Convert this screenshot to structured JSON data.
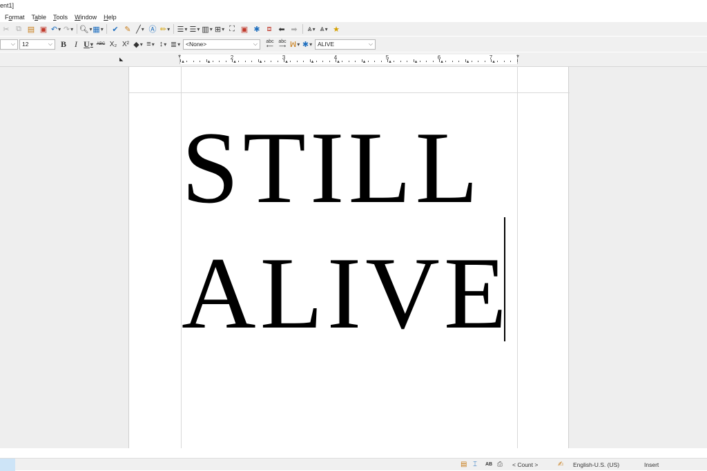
{
  "window": {
    "title_fragment": "ent1]"
  },
  "menu": [
    {
      "label": "Format",
      "key": "o"
    },
    {
      "label": "Table",
      "key": "a"
    },
    {
      "label": "Tools",
      "key": "T"
    },
    {
      "label": "Window",
      "key": "W"
    },
    {
      "label": "Help",
      "key": "H"
    }
  ],
  "formatting": {
    "font_size": "12",
    "bold": "B",
    "italic": "I",
    "underline": "U",
    "strikethrough": "ABC",
    "subscript": "X₂",
    "superscript": "X²",
    "paragraph_style": "<None>",
    "find_value": "ALIVE",
    "language_abc": "abc"
  },
  "ruler": {
    "numbers": [
      "2",
      "3",
      "4",
      "5",
      "6",
      "7"
    ]
  },
  "document": {
    "line1": "STILL",
    "line2": "ALIVE"
  },
  "status": {
    "word_count": "< Count >",
    "language": "English-U.S. (US)",
    "mode": "Insert",
    "ab": "AB"
  },
  "icons": {
    "undo": "undo-icon",
    "redo": "redo-icon",
    "paste": "paste-icon",
    "find": "find-icon",
    "star": "star-icon"
  },
  "colors": {
    "accent": "#1f6fbf",
    "toolbar_bg": "#f0f0f0",
    "workspace_bg": "#eeeeee"
  }
}
